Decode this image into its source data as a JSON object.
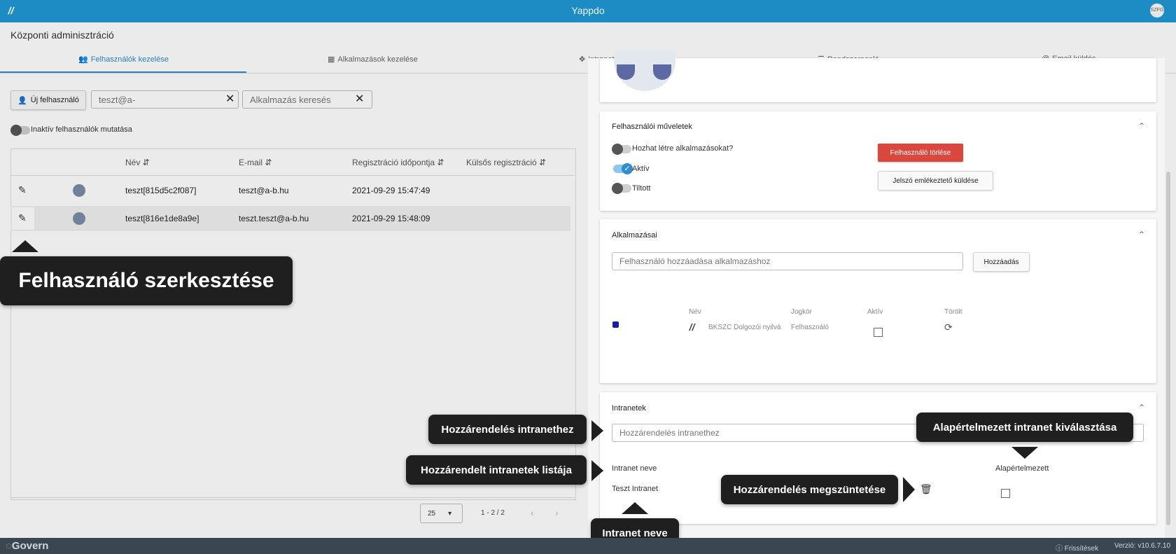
{
  "app": {
    "title": "Yappdo",
    "logo_icon": "yappdo-logo-icon",
    "avatar_initials": "SZFG"
  },
  "page": {
    "title": "Központi adminisztráció"
  },
  "tabs": [
    {
      "label": "Felhasználók kezelése",
      "icon": "users-icon",
      "active": true
    },
    {
      "label": "Alkalmazások kezelése",
      "icon": "apps-grid-icon"
    },
    {
      "label": "Intranetek kezelése",
      "icon": "network-icon"
    },
    {
      "label": "Rendszernapló",
      "icon": "list-icon"
    },
    {
      "label": "Email küldés",
      "icon": "at-icon"
    }
  ],
  "toolbar": {
    "new_user_label": "Új felhasználó",
    "search_value": "teszt@a-",
    "app_search_placeholder": "Alkalmazás keresés",
    "inactive_toggle_label": "Inaktív felhasználók mutatása"
  },
  "table": {
    "columns": [
      "Név",
      "E-mail",
      "Regisztráció időpontja",
      "Külsős regisztráció"
    ],
    "rows": [
      {
        "name": "teszt[815d5c2f087]",
        "email": "teszt@a-b.hu",
        "registered": "2021-09-29 15:47:49"
      },
      {
        "name": "teszt[816e1de8a9e]",
        "email": "teszt.teszt@a-b.hu",
        "registered": "2021-09-29 15:48:09"
      }
    ],
    "page_size": "25",
    "range": "1 - 2 / 2"
  },
  "user_ops": {
    "title": "Felhasználói műveletek",
    "can_create_label": "Hozhat létre alkalmazásokat?",
    "active_label": "Aktív",
    "banned_label": "Tiltott",
    "delete_label": "Felhasználó törlése",
    "reminder_label": "Jelszó emlékeztető küldése"
  },
  "apps": {
    "title": "Alkalmazásai",
    "add_placeholder": "Felhasználó hozzáadása alkalmazáshoz",
    "add_button": "Hozzáadás",
    "columns": [
      "Név",
      "Jogkör",
      "Aktív",
      "Törölt"
    ],
    "row": {
      "name": "BKSZC Dolgozói nyilvá",
      "role": "Felhasználó"
    }
  },
  "intranets": {
    "title": "Intranetek",
    "assign_placeholder": "Hozzárendelés intranethez",
    "col_name": "Intranet neve",
    "col_default": "Alapértelmezett",
    "row_name": "Teszt Intranet"
  },
  "tooltips": {
    "edit_user": "Felhasználó szerkesztése",
    "assign": "Hozzárendelés intranethez",
    "assigned_list": "Hozzárendelt intranetek listája",
    "default_select": "Alapértelmezett intranet kiválasztása",
    "unassign": "Hozzárendelés megszüntetése",
    "intranet_name": "Intranet neve"
  },
  "footer": {
    "brand": "Govern",
    "refresh": "Frissítések",
    "version": "Verzió: v10.6.7.10"
  },
  "colors": {
    "primary": "#1e8cc4",
    "accent": "#2f8dd0",
    "danger": "#d9473e",
    "footer": "#3a4752"
  }
}
